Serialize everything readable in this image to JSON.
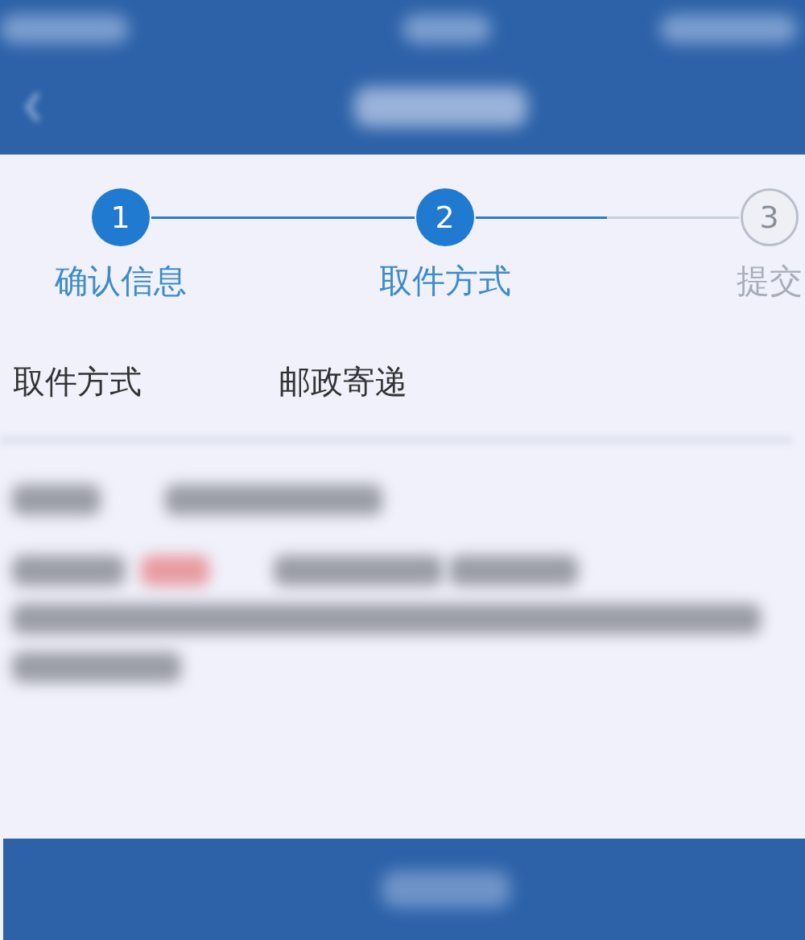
{
  "steps": [
    {
      "number": "1",
      "label": "确认信息",
      "reached": true,
      "connector": {
        "level": 1
      }
    },
    {
      "number": "2",
      "label": "取件方式",
      "reached": true,
      "connector": {
        "level": 0.5
      }
    },
    {
      "number": "3",
      "label": "提交",
      "reached": false
    }
  ],
  "pickup_row": {
    "label": "取件方式",
    "value": "邮政寄递"
  }
}
